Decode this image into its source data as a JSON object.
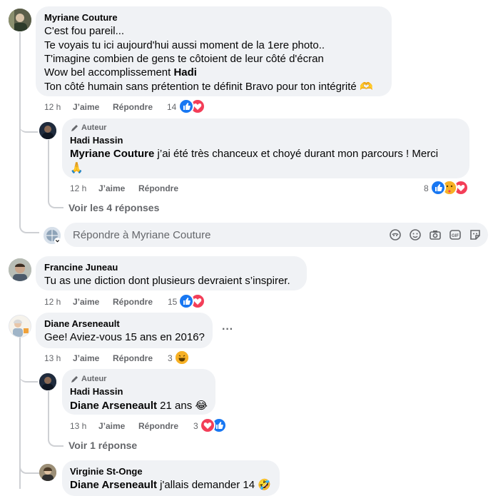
{
  "comments": [
    {
      "author": "Myriane Couture",
      "lines": [
        "C'est fou pareil...",
        "Te voyais tu ici aujourd'hui aussi moment de la 1ere photo..",
        "T'imagine combien de gens te côtoient de leur côté d'écran",
        "Wow bel accomplissement",
        "Ton côté humain sans prétention te définit Bravo pour ton intégrité"
      ],
      "line4_bold": "Hadi",
      "emoji_end": "🫶",
      "time": "12 h",
      "like": "J’aime",
      "reply": "Répondre",
      "count": "14"
    },
    {
      "badge": "Auteur",
      "author": "Hadi Hassin",
      "mention": "Myriane Couture",
      "text": " j’ai été très chanceux et choyé durant mon parcours ! Merci",
      "emoji": "🙏",
      "time": "12 h",
      "like": "J’aime",
      "reply": "Répondre",
      "count": "8"
    },
    {
      "author": "Francine Juneau",
      "text": "Tu as une diction dont plusieurs devraient s’inspirer.",
      "time": "12 h",
      "like": "J’aime",
      "reply": "Répondre",
      "count": "15"
    },
    {
      "author": "Diane Arseneault",
      "text": "Gee! Aviez-vous 15 ans en 2016?",
      "more": "···",
      "time": "13 h",
      "like": "J’aime",
      "reply": "Répondre",
      "count": "3"
    },
    {
      "badge": "Auteur",
      "author": "Hadi Hassin",
      "mention": "Diane Arseneault",
      "text": " 21 ans",
      "emoji": "😂",
      "time": "13 h",
      "like": "J’aime",
      "reply": "Répondre",
      "count": "3"
    },
    {
      "author": "Virginie St-Onge",
      "mention": "Diane Arseneault",
      "text": " j'allais demander 14",
      "emoji": "🤣"
    }
  ],
  "view_replies_1": "Voir les 4 réponses",
  "view_replies_2": "Voir 1 réponse",
  "reply_placeholder": "Répondre à Myriane Couture",
  "colors": {
    "bubble": "#f0f2f5",
    "like": "#1877f2",
    "love": "#f33e58",
    "meta": "#65676b"
  }
}
